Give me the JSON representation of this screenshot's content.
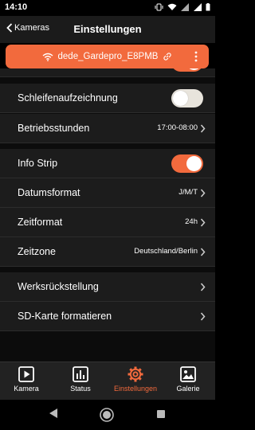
{
  "status": {
    "time": "14:10"
  },
  "header": {
    "back_label": "Kameras",
    "title": "Einstellungen"
  },
  "device": {
    "name": "dede_Gardepro_E8PMB",
    "color": "#f26a3d"
  },
  "settings": {
    "loop_recording": {
      "label": "Schleifenaufzeichnung",
      "enabled": false
    },
    "operating_hours": {
      "label": "Betriebsstunden",
      "value": "17:00-08:00"
    },
    "info_strip": {
      "label": "Info Strip",
      "enabled": true
    },
    "date_format": {
      "label": "Datumsformat",
      "value": "J/M/T"
    },
    "time_format": {
      "label": "Zeitformat",
      "value": "24h"
    },
    "time_zone": {
      "label": "Zeitzone",
      "value": "Deutschland/Berlin"
    },
    "factory_reset": {
      "label": "Werksrückstellung"
    },
    "format_sd": {
      "label": "SD-Karte formatieren"
    }
  },
  "tabs": [
    {
      "label": "Kamera",
      "icon": "play-icon",
      "active": false
    },
    {
      "label": "Status",
      "icon": "bar-chart-icon",
      "active": false
    },
    {
      "label": "Einstellungen",
      "icon": "gear-icon",
      "active": true
    },
    {
      "label": "Galerie",
      "icon": "image-icon",
      "active": false
    }
  ],
  "colors": {
    "accent": "#f26a3d",
    "row_bg": "#1c1c1c",
    "page_bg": "#0c0c0c"
  }
}
